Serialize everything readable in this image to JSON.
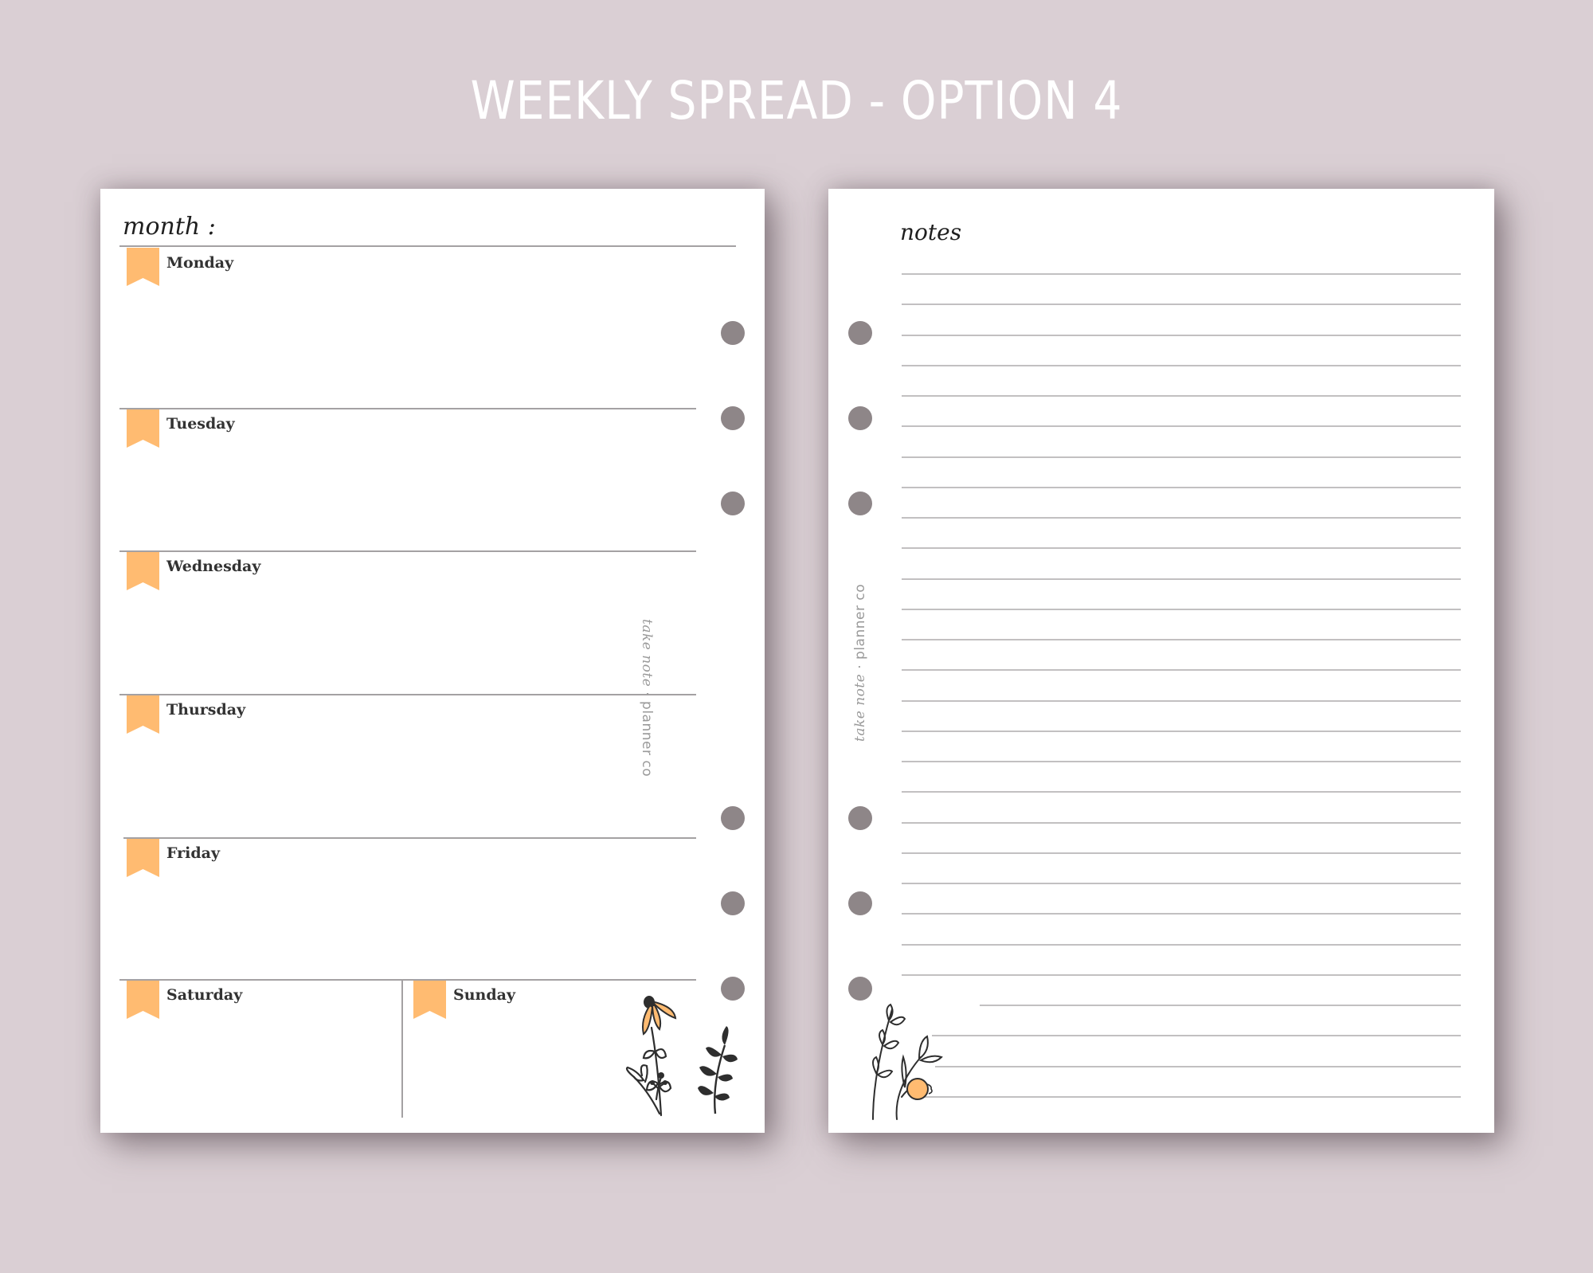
{
  "title": "WEEKLY SPREAD - OPTION 4",
  "colors": {
    "background": "#dacfd4",
    "accent": "#ffbb71",
    "ink": "#333333",
    "hole": "#8e8688",
    "rule": "#a4a1a3"
  },
  "left_page": {
    "month_label": "month :",
    "days": [
      {
        "label": "Monday",
        "icon": "ribbon-bookmark-icon"
      },
      {
        "label": "Tuesday",
        "icon": "ribbon-bookmark-icon"
      },
      {
        "label": "Wednesday",
        "icon": "ribbon-bookmark-icon"
      },
      {
        "label": "Thursday",
        "icon": "ribbon-bookmark-icon"
      },
      {
        "label": "Friday",
        "icon": "ribbon-bookmark-icon"
      },
      {
        "label": "Saturday",
        "icon": "ribbon-bookmark-icon"
      },
      {
        "label": "Sunday",
        "icon": "ribbon-bookmark-icon"
      }
    ],
    "brand_script": "take note",
    "brand_separator": "·",
    "brand_text": "planner co",
    "illustration": "wildflower-illustration-icon"
  },
  "right_page": {
    "notes_label": "notes",
    "line_count": 28,
    "brand_script": "take note",
    "brand_separator": "·",
    "brand_text": "planner co",
    "illustration": "berry-sprig-illustration-icon"
  }
}
